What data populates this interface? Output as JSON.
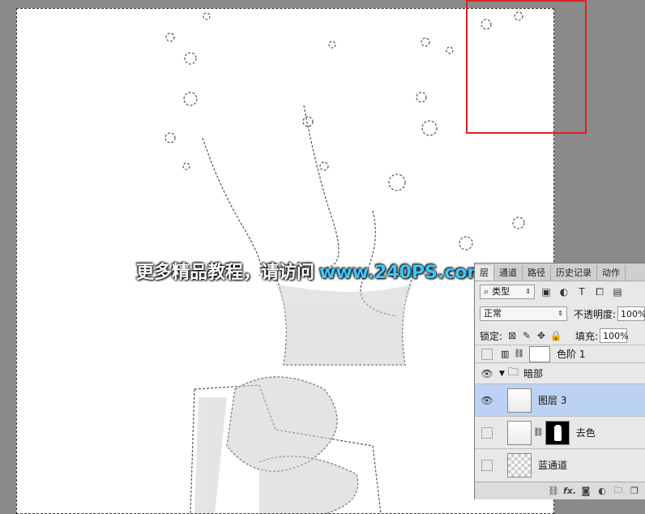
{
  "watermark": {
    "text": "更多精品教程，请访问",
    "url": "www.240PS.com"
  },
  "panel": {
    "tabs": [
      "层",
      "通道",
      "路径",
      "历史记录",
      "动作"
    ],
    "active_tab": 0,
    "filter": {
      "kind_label": "类型"
    },
    "blend": {
      "mode": "正常",
      "opacity_label": "不透明度:",
      "opacity_value": "100%"
    },
    "lock": {
      "label": "锁定:",
      "fill_label": "填充:",
      "fill_value": "100%"
    },
    "layers": [
      {
        "name": "色阶 1",
        "visible": false
      },
      {
        "name": "暗部",
        "visible": true,
        "group": true
      },
      {
        "name": "图层 3",
        "visible": true,
        "selected": true
      },
      {
        "name": "去色",
        "visible": false
      },
      {
        "name": "蓝通道",
        "visible": false
      }
    ],
    "bottom_icons": [
      "link-icon",
      "fx-icon",
      "mask-icon",
      "adjustment-icon",
      "folder-icon",
      "new-layer-icon"
    ],
    "bottom_fx_label": "fx."
  },
  "colors": {
    "selection_box": "#e02020",
    "watermark_url": "#3cc9ff",
    "selected_layer": "#bcd2f4"
  }
}
